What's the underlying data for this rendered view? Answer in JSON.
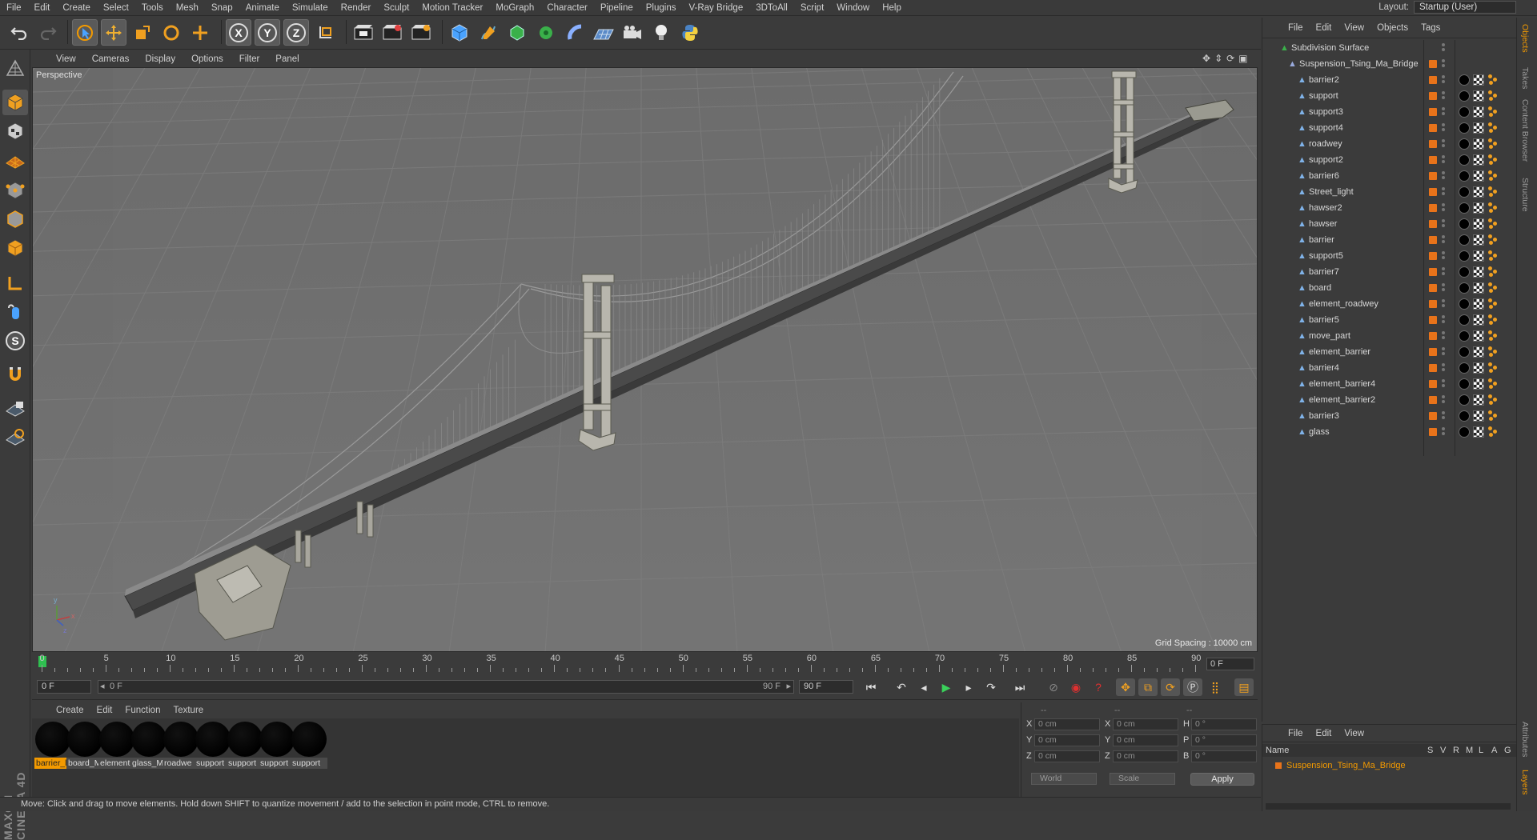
{
  "menubar": {
    "items": [
      "File",
      "Edit",
      "Create",
      "Select",
      "Tools",
      "Mesh",
      "Snap",
      "Animate",
      "Simulate",
      "Render",
      "Sculpt",
      "Motion Tracker",
      "MoGraph",
      "Character",
      "Pipeline",
      "Plugins",
      "V-Ray Bridge",
      "3DToAll",
      "Script",
      "Window",
      "Help"
    ],
    "layout_label": "Layout:",
    "layout_value": "Startup (User)"
  },
  "viewport": {
    "menu": [
      "View",
      "Cameras",
      "Display",
      "Options",
      "Filter",
      "Panel"
    ],
    "label": "Perspective",
    "grid_spacing": "Grid Spacing : 10000 cm",
    "axis_labels": {
      "x": "x",
      "y": "y",
      "z": "z"
    }
  },
  "timeline": {
    "ticks": [
      0,
      5,
      10,
      15,
      20,
      25,
      30,
      35,
      40,
      45,
      50,
      55,
      60,
      65,
      70,
      75,
      80,
      85,
      90
    ],
    "current_frame_right": "0 F"
  },
  "transport": {
    "start_field": "0 F",
    "range_left": "0 F",
    "range_right": "90 F",
    "end_field": "90 F"
  },
  "materials": {
    "menu": [
      "Create",
      "Edit",
      "Function",
      "Texture"
    ],
    "items": [
      "barrier_l",
      "board_M",
      "element",
      "glass_M",
      "roadwe",
      "support",
      "support",
      "support",
      "support"
    ]
  },
  "coordinates": {
    "headers": [
      "--",
      "--",
      "--"
    ],
    "rows": [
      {
        "a": "X",
        "av": "0 cm",
        "b": "X",
        "bv": "0 cm",
        "c": "H",
        "cv": "0 °"
      },
      {
        "a": "Y",
        "av": "0 cm",
        "b": "Y",
        "bv": "0 cm",
        "c": "P",
        "cv": "0 °"
      },
      {
        "a": "Z",
        "av": "0 cm",
        "b": "Z",
        "bv": "0 cm",
        "c": "B",
        "cv": "0 °"
      }
    ],
    "mode_world": "World",
    "mode_scale": "Scale",
    "apply": "Apply"
  },
  "status": "Move: Click and drag to move elements. Hold down SHIFT to quantize movement / add to the selection in point mode, CTRL to remove.",
  "object_manager": {
    "menu": [
      "File",
      "Edit",
      "View",
      "Objects",
      "Tags"
    ],
    "root": "Subdivision Surface",
    "group": "Suspension_Tsing_Ma_Bridge",
    "children": [
      "barrier2",
      "support",
      "support3",
      "support4",
      "roadwey",
      "support2",
      "barrier6",
      "Street_light",
      "hawser2",
      "hawser",
      "barrier",
      "support5",
      "barrier7",
      "board",
      "element_roadwey",
      "barrier5",
      "move_part",
      "element_barrier",
      "barrier4",
      "element_barrier4",
      "element_barrier2",
      "barrier3",
      "glass"
    ]
  },
  "layers": {
    "menu": [
      "File",
      "Edit",
      "View"
    ],
    "header_name": "Name",
    "header_cols": [
      "S",
      "V",
      "R",
      "M",
      "L",
      "A",
      "G"
    ],
    "row": "Suspension_Tsing_Ma_Bridge"
  },
  "side_tabs": [
    "Objects",
    "Takes",
    "Content Browser",
    "Structure",
    "Attributes",
    "Layers"
  ]
}
